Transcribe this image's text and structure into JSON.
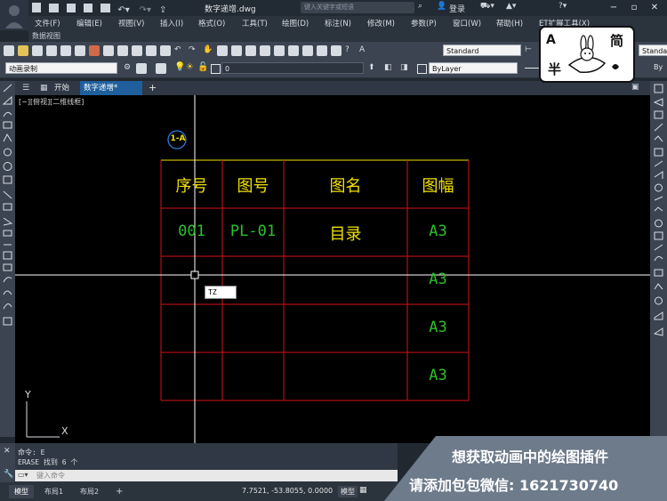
{
  "title_bar": {
    "document_title": "数字递增.dwg",
    "search_placeholder": "键入关键字或短语",
    "login_label": "登录",
    "help_label": "?"
  },
  "menu": [
    "文件(F)",
    "编辑(E)",
    "视图(V)",
    "插入(I)",
    "格式(O)",
    "工具(T)",
    "绘图(D)",
    "标注(N)",
    "修改(M)",
    "参数(P)",
    "窗口(W)",
    "帮助(H)",
    "ET扩展工具(X)"
  ],
  "sub_menu": "数据视图",
  "toolbar": {
    "text_style": "Standard",
    "dim_style_right": "Standa",
    "workspace": "动画录制",
    "layer": "0",
    "color": "ByLayer",
    "linetype_right": "By"
  },
  "tabs": {
    "start_label": "开始",
    "file_tab_label": "数字递增*",
    "add_tab": "+"
  },
  "viewport_label": "[−][俯视][二维线框]",
  "drawing": {
    "balloon_label": "1-A",
    "headers": [
      "序号",
      "图号",
      "图名",
      "图幅"
    ],
    "rows": [
      [
        "001",
        "PL-01",
        "目录",
        "A3"
      ],
      [
        "",
        "",
        "",
        "A3"
      ],
      [
        "",
        "",
        "",
        "A3"
      ],
      [
        "",
        "",
        "",
        "A3"
      ]
    ],
    "input_tooltip": "TZ",
    "ucs_x": "X",
    "ucs_y": "Y",
    "colors": {
      "table_border": "#d41414",
      "header_text": "#f0e000",
      "number_text": "#2dbf2d",
      "name_text": "#f0e000",
      "size_text": "#2dbf2d",
      "crosshair": "#ffffff"
    }
  },
  "command": {
    "line1": "命令: E",
    "line2": "ERASE 找到 6 个",
    "input_placeholder": "键入命令"
  },
  "status": {
    "layout_tabs": [
      "模型",
      "布局1",
      "布局2"
    ],
    "add_layout": "+",
    "coordinates": "7.7521, -53.8055, 0.0000",
    "model_label": "模型"
  },
  "overlay": {
    "line1": "想获取动画中的绘图插件",
    "line2": "请添加包包微信: 1621730740",
    "logo_char1": "A",
    "logo_char2": "简",
    "logo_char3": "半"
  }
}
